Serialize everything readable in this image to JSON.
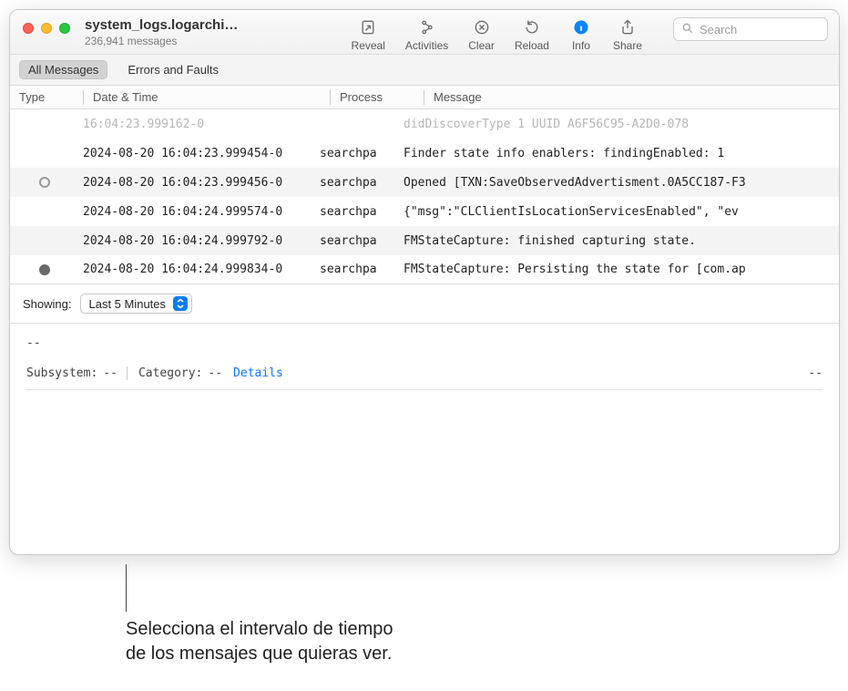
{
  "window": {
    "title": "system_logs.logarchi…",
    "subtitle": "236,941 messages"
  },
  "toolbar": {
    "reveal": "Reveal",
    "activities": "Activities",
    "clear": "Clear",
    "reload": "Reload",
    "info": "Info",
    "share": "Share",
    "search_placeholder": "Search"
  },
  "filters": {
    "all": "All Messages",
    "errors": "Errors and Faults"
  },
  "columns": {
    "type": "Type",
    "datetime": "Date & Time",
    "process": "Process",
    "message": "Message"
  },
  "rows": [
    {
      "dim": true,
      "alt": false,
      "type": "",
      "dt": " 16:04:23.999162-0",
      "proc": "",
      "msg": "didDiscoverType 1 UUID A6F56C95-A2D0-078"
    },
    {
      "dim": false,
      "alt": false,
      "type": "",
      "dt": "2024-08-20 16:04:23.999454-0",
      "proc": "searchpa",
      "msg": "Finder state info enablers:   findingEnabled: 1"
    },
    {
      "dim": false,
      "alt": true,
      "type": "hollow",
      "dt": "2024-08-20 16:04:23.999456-0",
      "proc": "searchpa",
      "msg": "Opened [TXN:SaveObservedAdvertisment.0A5CC187-F3"
    },
    {
      "dim": false,
      "alt": false,
      "type": "",
      "dt": "2024-08-20 16:04:24.999574-0",
      "proc": "searchpa",
      "msg": "{\"msg\":\"CLClientIsLocationServicesEnabled\", \"ev"
    },
    {
      "dim": false,
      "alt": true,
      "type": "",
      "dt": "2024-08-20 16:04:24.999792-0",
      "proc": "searchpa",
      "msg": "FMStateCapture: finished capturing state."
    },
    {
      "dim": false,
      "alt": false,
      "type": "solid",
      "dt": "2024-08-20 16:04:24.999834-0",
      "proc": "searchpa",
      "msg": "FMStateCapture: Persisting the state for [com.ap"
    }
  ],
  "showing": {
    "label": "Showing:",
    "value": "Last 5 Minutes"
  },
  "detail": {
    "top_dashes": "--",
    "subsystem_label": "Subsystem:",
    "subsystem_value": "--",
    "category_label": "Category:",
    "category_value": "--",
    "details_link": "Details",
    "right_dashes": "--"
  },
  "callout": {
    "line1": "Selecciona el intervalo de tiempo",
    "line2": "de los mensajes que quieras ver."
  }
}
